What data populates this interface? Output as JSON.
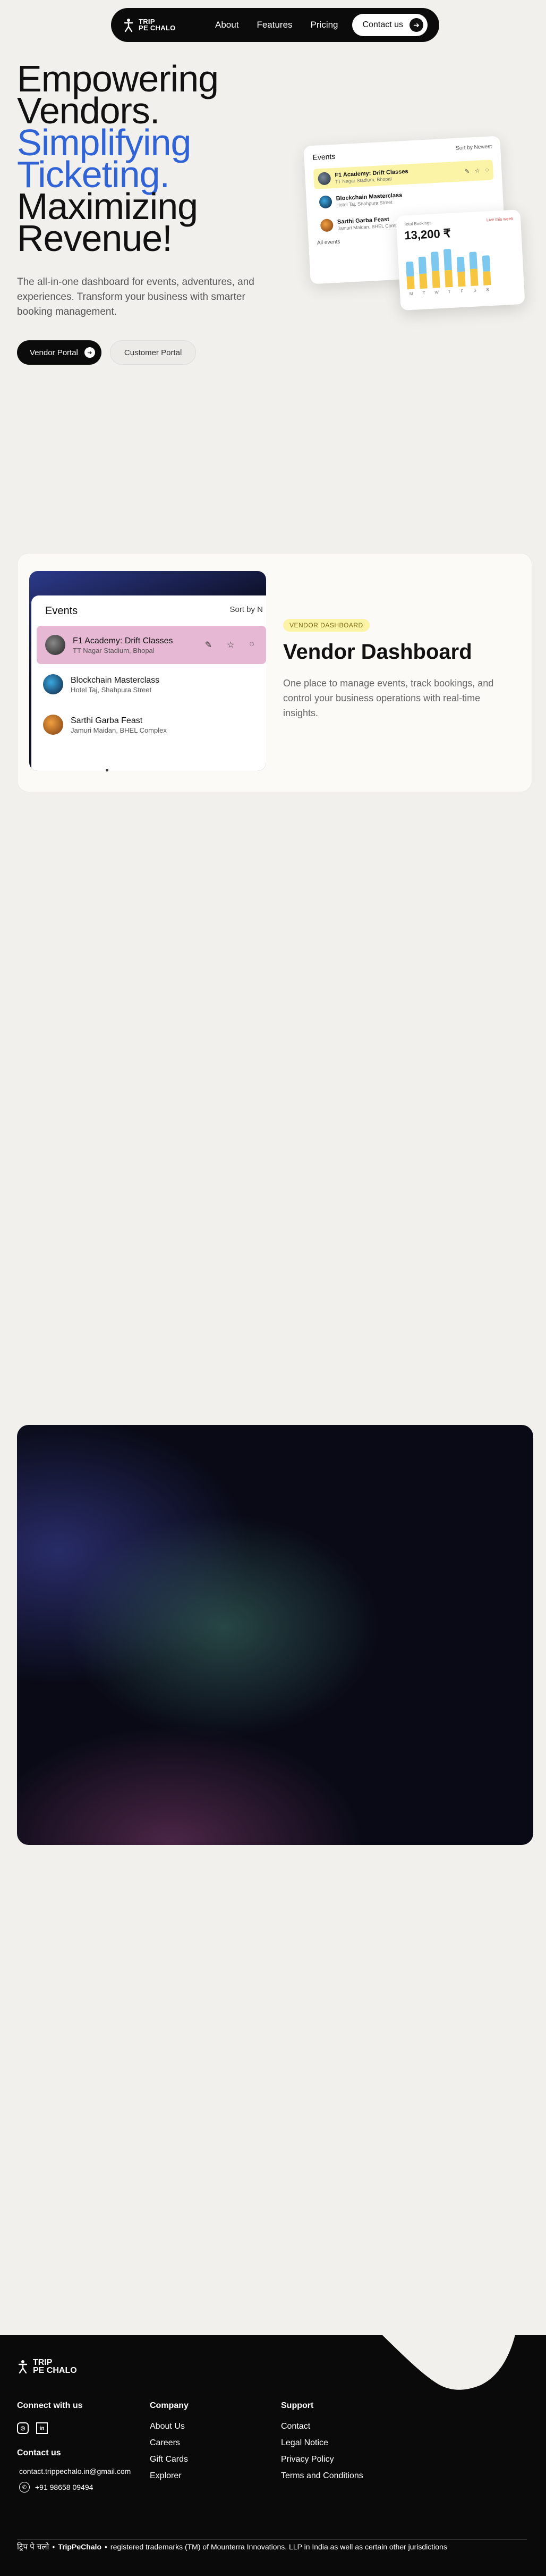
{
  "nav": {
    "logo_line1": "TRIP",
    "logo_line2": "PE CHALO",
    "links": [
      "About",
      "Features",
      "Pricing"
    ],
    "contact_label": "Contact us"
  },
  "hero": {
    "title_line1": "Empowering",
    "title_line2": "Vendors.",
    "title_line3": "Simplifying",
    "title_line4": "Ticketing.",
    "title_line5": "Maximizing",
    "title_line6": "Revenue!",
    "subtitle": "The all-in-one dashboard for events, adventures, and experiences. Transform your business with smarter booking management.",
    "vendor_portal_label": "Vendor Portal",
    "customer_portal_label": "Customer Portal",
    "accent_color": "#2f63d6"
  },
  "events_card": {
    "title": "Events",
    "sort_label": "Sort by Newest",
    "events": [
      {
        "name": "F1 Academy: Drift Classes",
        "location": "TT Nagar Stadium, Bhopal"
      },
      {
        "name": "Blockchain Masterclass",
        "location": "Hotel Taj, Shahpura Street"
      },
      {
        "name": "Sarthi Garba Feast",
        "location": "Jamuri Maidan, BHEL Comp"
      }
    ],
    "footer_label": "All events"
  },
  "bookings_card": {
    "label": "Total Bookings",
    "live_label": "Live this week",
    "value": "13,200 ₹",
    "days": [
      "M",
      "T",
      "W",
      "T",
      "F",
      "S",
      "S"
    ],
    "bars": [
      {
        "blue": 0.35,
        "yellow": 0.3
      },
      {
        "blue": 0.4,
        "yellow": 0.35
      },
      {
        "blue": 0.45,
        "yellow": 0.4
      },
      {
        "blue": 0.5,
        "yellow": 0.4
      },
      {
        "blue": 0.35,
        "yellow": 0.35
      },
      {
        "blue": 0.4,
        "yellow": 0.4
      },
      {
        "blue": 0.38,
        "yellow": 0.32
      }
    ]
  },
  "vendor_section": {
    "events_title": "Events",
    "sort_label": "Sort by N",
    "events": [
      {
        "name": "F1 Academy: Drift Classes",
        "location": "TT Nagar Stadium, Bhopal"
      },
      {
        "name": "Blockchain Masterclass",
        "location": "Hotel Taj, Shahpura Street"
      },
      {
        "name": "Sarthi Garba Feast",
        "location": "Jamuri Maidan, BHEL Complex"
      }
    ],
    "tag": "VENDOR DASHBOARD",
    "title": "Vendor Dashboard",
    "description": "One place to manage events, track bookings, and control your business operations with real-time insights."
  },
  "footer": {
    "logo_line1": "TRIP",
    "logo_line2": "PE CHALO",
    "connect_heading": "Connect with us",
    "contact_heading": "Contact us",
    "email": "contact.trippechalo.in@gmail.com",
    "phone": "+91 98658 09494",
    "company_heading": "Company",
    "company_links": [
      "About Us",
      "Careers",
      "Gift Cards",
      "Explorer"
    ],
    "support_heading": "Support",
    "support_links": [
      "Contact",
      "Legal Notice",
      "Privacy Policy",
      "Terms and Conditions"
    ],
    "legal_devanagari": "ट्रिप पे चलो",
    "legal_brand": "TripPeChalo",
    "legal_text": "registered trademarks (TM) of Mounterra Innovations. LLP in India as well as certain other jurisdictions"
  }
}
